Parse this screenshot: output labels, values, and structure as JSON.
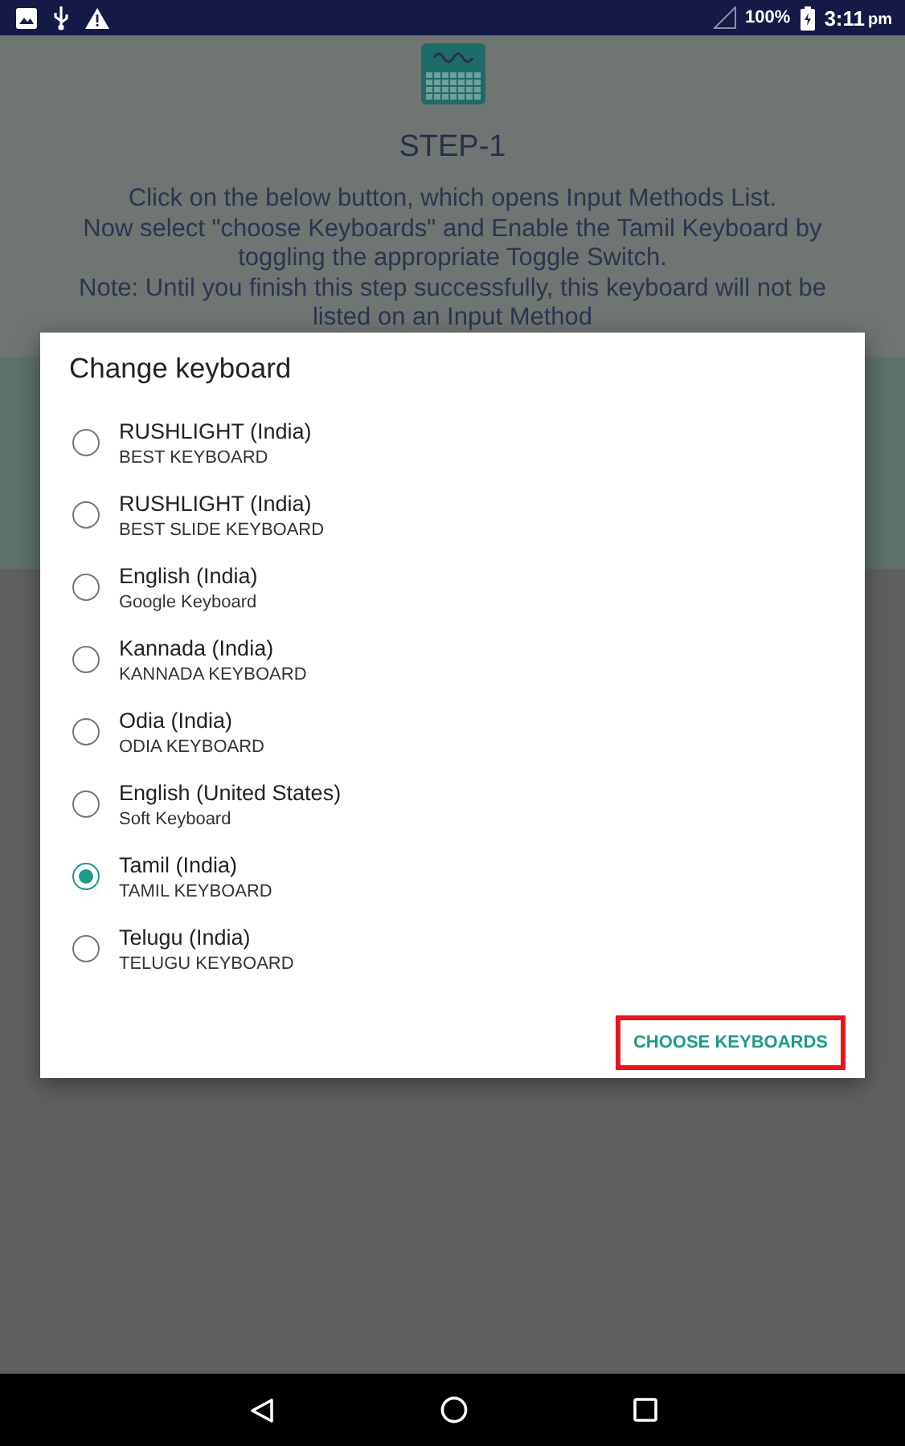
{
  "status_bar": {
    "battery": "100%",
    "time": "3:11",
    "time_suffix": "pm"
  },
  "app": {
    "title": "STEP-1",
    "lines": [
      "Click on the below button, which opens Input Methods List.",
      "Now select \"choose Keyboards\" and Enable the Tamil Keyboard by",
      "toggling the appropriate Toggle Switch.",
      "Note: Until you finish this step successfully, this keyboard will not be",
      "listed on an Input Method"
    ]
  },
  "dialog": {
    "title": "Change keyboard",
    "options": [
      {
        "label": "RUSHLIGHT (India)",
        "sublabel": "BEST KEYBOARD",
        "selected": false
      },
      {
        "label": "RUSHLIGHT (India)",
        "sublabel": "BEST SLIDE KEYBOARD",
        "selected": false
      },
      {
        "label": "English (India)",
        "sublabel": "Google Keyboard",
        "selected": false
      },
      {
        "label": "Kannada (India)",
        "sublabel": "KANNADA KEYBOARD",
        "selected": false
      },
      {
        "label": "Odia (India)",
        "sublabel": "ODIA KEYBOARD",
        "selected": false
      },
      {
        "label": "English (United States)",
        "sublabel": "Soft Keyboard",
        "selected": false
      },
      {
        "label": "Tamil (India)",
        "sublabel": "TAMIL KEYBOARD",
        "selected": true
      },
      {
        "label": "Telugu (India)",
        "sublabel": "TELUGU KEYBOARD",
        "selected": false
      }
    ],
    "button": {
      "label": "CHOOSE KEYBOARDS",
      "highlighted": true
    }
  }
}
